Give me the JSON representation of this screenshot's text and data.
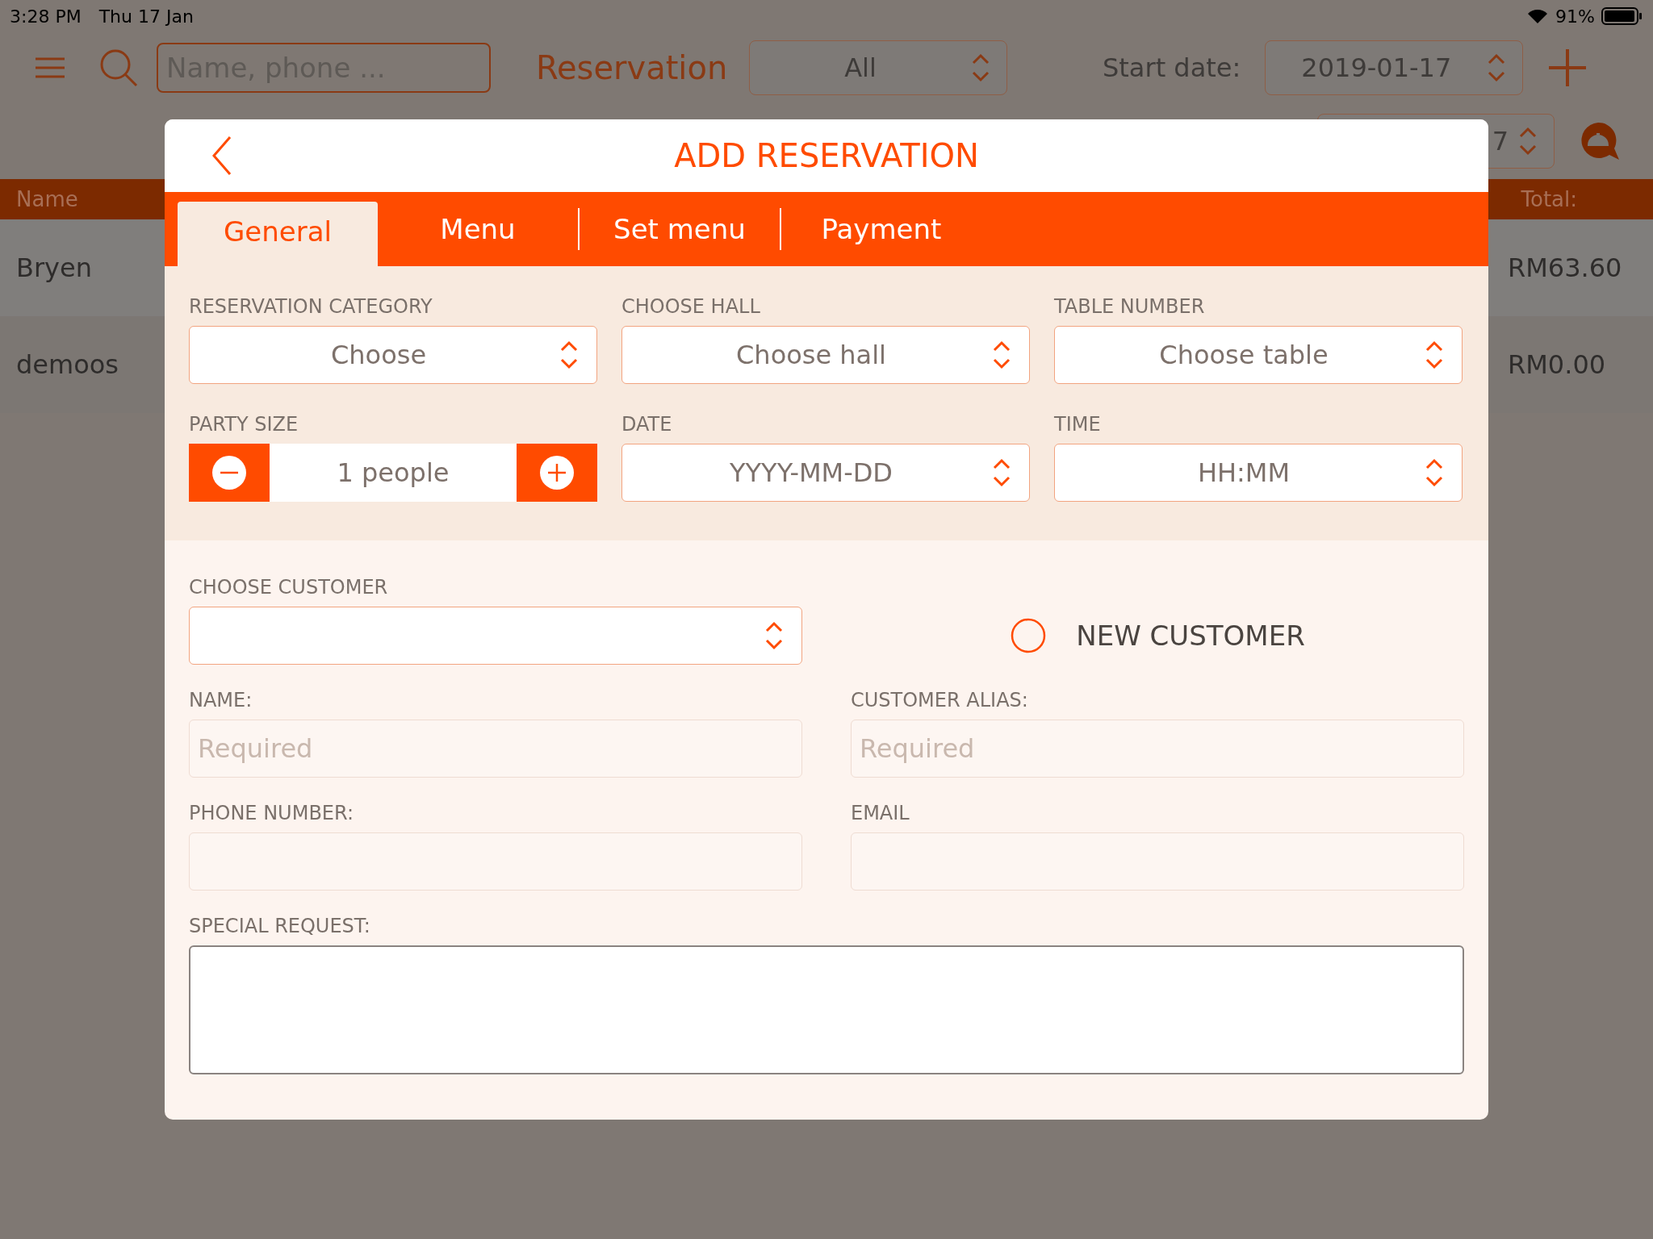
{
  "status_bar": {
    "time": "3:28 PM",
    "date": "Thu 17 Jan",
    "battery": "91%"
  },
  "toolbar": {
    "search": {
      "placeholder": "Name, phone ..."
    },
    "title": "Reservation",
    "filter": {
      "value": "All"
    },
    "start_date_label": "Start date:",
    "start_date": {
      "value": "2019-01-17"
    },
    "end_date": {
      "value": "7"
    }
  },
  "table": {
    "columns": [
      {
        "label": "Name"
      },
      {
        "label": "Total:"
      }
    ],
    "rows": [
      {
        "name": "Bryen",
        "total": "RM63.60"
      },
      {
        "name": "demoos",
        "total": "RM0.00"
      }
    ]
  },
  "dialog": {
    "title": "ADD RESERVATION",
    "tabs": [
      {
        "label": "General",
        "selected": true
      },
      {
        "label": "Menu",
        "selected": false
      },
      {
        "label": "Set menu",
        "selected": false
      },
      {
        "label": "Payment",
        "selected": false
      }
    ],
    "fields": [
      {
        "label": "RESERVATION CATEGORY",
        "kind": "select",
        "value": "Choose"
      },
      {
        "label": "CHOOSE HALL",
        "kind": "select",
        "value": "Choose hall"
      },
      {
        "label": "TABLE NUMBER",
        "kind": "select",
        "value": "Choose table"
      },
      {
        "label": "PARTY SIZE",
        "kind": "stepper",
        "value": "1 people"
      },
      {
        "label": "DATE",
        "kind": "select",
        "value": "YYYY-MM-DD"
      },
      {
        "label": "TIME",
        "kind": "select",
        "value": "HH:MM"
      }
    ],
    "customer": {
      "label": "CHOOSE CUSTOMER",
      "new_customer": {
        "label": "NEW CUSTOMER",
        "checked": false
      }
    },
    "inputs": [
      {
        "label": "NAME:",
        "placeholder": "Required"
      },
      {
        "label": "CUSTOMER ALIAS:",
        "placeholder": "Required"
      },
      {
        "label": "PHONE NUMBER:"
      },
      {
        "label": "EMAIL"
      }
    ],
    "special_request": {
      "label": "SPECIAL REQUEST:"
    }
  }
}
